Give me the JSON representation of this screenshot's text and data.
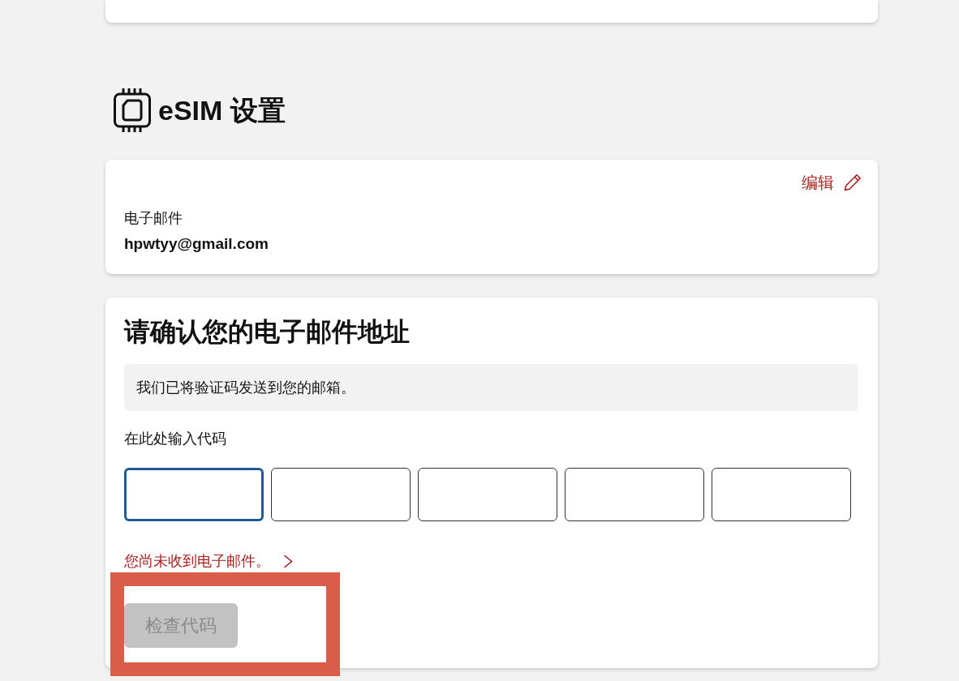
{
  "section": {
    "title": "eSIM 设置"
  },
  "email_card": {
    "edit_link": "编辑",
    "label": "电子邮件",
    "value": "hpwtyy@gmail.com"
  },
  "verify_card": {
    "title": "请确认您的电子邮件地址",
    "notice": "我们已将验证码发送到您的邮箱。",
    "code_label": "在此处输入代码",
    "code_fields": [
      {
        "focused": true
      },
      {
        "focused": false
      },
      {
        "focused": false
      },
      {
        "focused": false
      },
      {
        "focused": false
      }
    ],
    "resend_link": "您尚未收到电子邮件。",
    "check_button": {
      "label": "检查代码",
      "disabled": true,
      "highlighted": true
    }
  }
}
